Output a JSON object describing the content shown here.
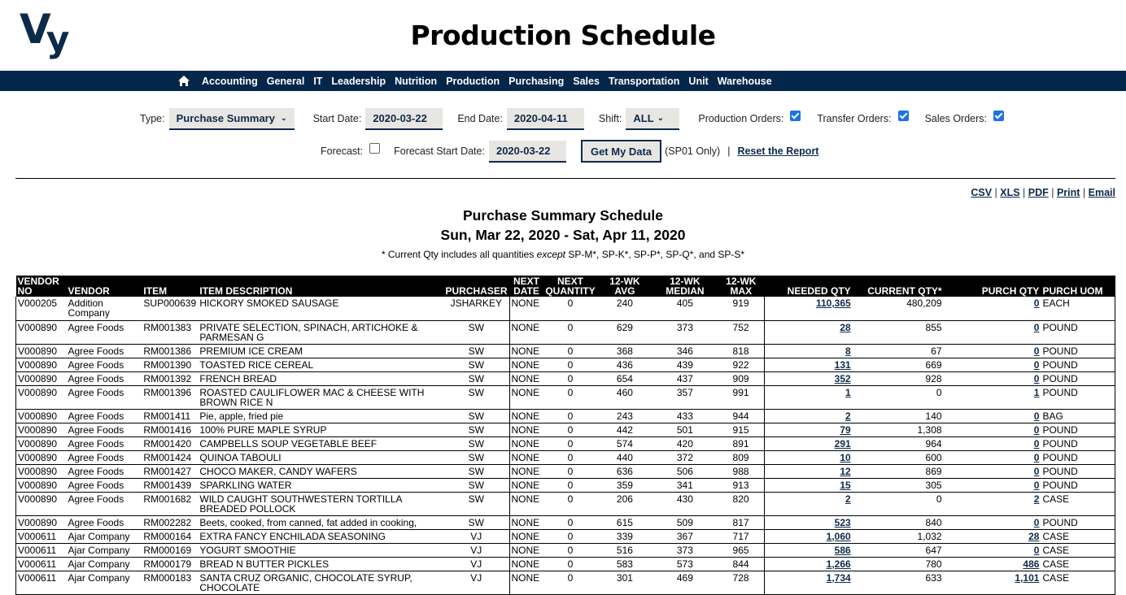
{
  "header": {
    "logo_text_v": "V",
    "logo_text_y": "y",
    "title": "Production Schedule"
  },
  "nav": {
    "home_icon": "home-icon",
    "items": [
      "Accounting",
      "General",
      "IT",
      "Leadership",
      "Nutrition",
      "Production",
      "Purchasing",
      "Sales",
      "Transportation",
      "Unit",
      "Warehouse"
    ]
  },
  "filters": {
    "type_label": "Type:",
    "type_value": "Purchase Summary",
    "start_label": "Start Date:",
    "start_value": "2020-03-22",
    "end_label": "End Date:",
    "end_value": "2020-04-11",
    "shift_label": "Shift:",
    "shift_value": "ALL",
    "production_orders_label": "Production Orders:",
    "production_orders_checked": true,
    "transfer_orders_label": "Transfer Orders:",
    "transfer_orders_checked": true,
    "sales_orders_label": "Sales Orders:",
    "sales_orders_checked": true,
    "forecast_label": "Forecast:",
    "forecast_checked": false,
    "forecast_start_label": "Forecast Start Date:",
    "forecast_start_value": "2020-03-22",
    "get_data_label": "Get My Data",
    "sp01_note": "(SP01 Only)",
    "separator": "|",
    "reset_label": "Reset the Report"
  },
  "exports": {
    "items": [
      "CSV",
      "XLS",
      "PDF",
      "Print",
      "Email"
    ],
    "separator": " | "
  },
  "report": {
    "title": "Purchase Summary Schedule",
    "date_range": "Sun, Mar 22, 2020 - Sat, Apr 11, 2020",
    "note_prefix": "* Current Qty includes all quantities ",
    "note_em": "except",
    "note_suffix": " SP-M*, SP-K*, SP-P*, SP-Q*, and SP-S*"
  },
  "table": {
    "columns": [
      "VENDOR NO",
      "VENDOR",
      "ITEM",
      "ITEM DESCRIPTION",
      "PURCHASER",
      "NEXT DATE",
      "NEXT QUANTITY",
      "12-WK AVG",
      "12-WK MEDIAN",
      "12-WK MAX",
      "NEEDED QTY",
      "CURRENT QTY*",
      "PURCH QTY",
      "PURCH UOM"
    ],
    "rows": [
      [
        "V000205",
        "Addition Company",
        "SUP000639",
        "HICKORY SMOKED SAUSAGE",
        "JSHARKEY",
        "NONE",
        "0",
        "240",
        "405",
        "919",
        "110,365",
        "480,209",
        "0",
        "EACH"
      ],
      [
        "V000890",
        "Agree Foods",
        "RM001383",
        "PRIVATE SELECTION, SPINACH, ARTICHOKE & PARMESAN G",
        "SW",
        "NONE",
        "0",
        "629",
        "373",
        "752",
        "28",
        "855",
        "0",
        "POUND"
      ],
      [
        "V000890",
        "Agree Foods",
        "RM001386",
        "PREMIUM ICE CREAM",
        "SW",
        "NONE",
        "0",
        "368",
        "346",
        "818",
        "8",
        "67",
        "0",
        "POUND"
      ],
      [
        "V000890",
        "Agree Foods",
        "RM001390",
        "TOASTED RICE CEREAL",
        "SW",
        "NONE",
        "0",
        "436",
        "439",
        "922",
        "131",
        "669",
        "0",
        "POUND"
      ],
      [
        "V000890",
        "Agree Foods",
        "RM001392",
        "FRENCH BREAD",
        "SW",
        "NONE",
        "0",
        "654",
        "437",
        "909",
        "352",
        "928",
        "0",
        "POUND"
      ],
      [
        "V000890",
        "Agree Foods",
        "RM001396",
        "ROASTED CAULIFLOWER MAC & CHEESE WITH BROWN RICE N",
        "SW",
        "NONE",
        "0",
        "460",
        "357",
        "991",
        "1",
        "0",
        "1",
        "POUND"
      ],
      [
        "V000890",
        "Agree Foods",
        "RM001411",
        "Pie, apple, fried pie",
        "SW",
        "NONE",
        "0",
        "243",
        "433",
        "944",
        "2",
        "140",
        "0",
        "BAG"
      ],
      [
        "V000890",
        "Agree Foods",
        "RM001416",
        "100% PURE MAPLE SYRUP",
        "SW",
        "NONE",
        "0",
        "442",
        "501",
        "915",
        "79",
        "1,308",
        "0",
        "POUND"
      ],
      [
        "V000890",
        "Agree Foods",
        "RM001420",
        "CAMPBELLS SOUP VEGETABLE BEEF",
        "SW",
        "NONE",
        "0",
        "574",
        "420",
        "891",
        "291",
        "964",
        "0",
        "POUND"
      ],
      [
        "V000890",
        "Agree Foods",
        "RM001424",
        "QUINOA TABOULI",
        "SW",
        "NONE",
        "0",
        "440",
        "372",
        "809",
        "10",
        "600",
        "0",
        "POUND"
      ],
      [
        "V000890",
        "Agree Foods",
        "RM001427",
        "CHOCO MAKER, CANDY WAFERS",
        "SW",
        "NONE",
        "0",
        "636",
        "506",
        "988",
        "12",
        "869",
        "0",
        "POUND"
      ],
      [
        "V000890",
        "Agree Foods",
        "RM001439",
        "SPARKLING WATER",
        "SW",
        "NONE",
        "0",
        "359",
        "341",
        "913",
        "15",
        "305",
        "0",
        "POUND"
      ],
      [
        "V000890",
        "Agree Foods",
        "RM001682",
        "WILD CAUGHT SOUTHWESTERN TORTILLA BREADED POLLOCK",
        "SW",
        "NONE",
        "0",
        "206",
        "430",
        "820",
        "2",
        "0",
        "2",
        "CASE"
      ],
      [
        "V000890",
        "Agree Foods",
        "RM002282",
        "Beets, cooked, from canned, fat added in cooking,",
        "SW",
        "NONE",
        "0",
        "615",
        "509",
        "817",
        "523",
        "840",
        "0",
        "POUND"
      ],
      [
        "V000611",
        "Ajar Company",
        "RM000164",
        "EXTRA FANCY ENCHILADA SEASONING",
        "VJ",
        "NONE",
        "0",
        "339",
        "367",
        "717",
        "1,060",
        "1,032",
        "28",
        "CASE"
      ],
      [
        "V000611",
        "Ajar Company",
        "RM000169",
        "YOGURT SMOOTHIE",
        "VJ",
        "NONE",
        "0",
        "516",
        "373",
        "965",
        "586",
        "647",
        "0",
        "CASE"
      ],
      [
        "V000611",
        "Ajar Company",
        "RM000179",
        "BREAD N BUTTER PICKLES",
        "VJ",
        "NONE",
        "0",
        "583",
        "573",
        "844",
        "1,266",
        "780",
        "486",
        "CASE"
      ],
      [
        "V000611",
        "Ajar Company",
        "RM000183",
        "SANTA CRUZ ORGANIC, CHOCOLATE SYRUP, CHOCOLATE",
        "VJ",
        "NONE",
        "0",
        "301",
        "469",
        "728",
        "1,734",
        "633",
        "1,101",
        "CASE"
      ]
    ]
  }
}
